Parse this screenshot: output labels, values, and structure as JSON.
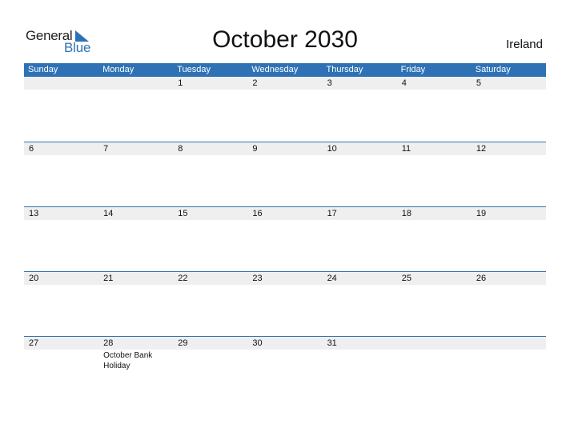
{
  "logo": {
    "word1": "General",
    "word2": "Blue"
  },
  "calendar": {
    "title": "October 2030",
    "country": "Ireland",
    "accent_color": "#2e72b5",
    "weekdays": [
      "Sunday",
      "Monday",
      "Tuesday",
      "Wednesday",
      "Thursday",
      "Friday",
      "Saturday"
    ],
    "weeks": [
      [
        {
          "day": ""
        },
        {
          "day": ""
        },
        {
          "day": "1"
        },
        {
          "day": "2"
        },
        {
          "day": "3"
        },
        {
          "day": "4"
        },
        {
          "day": "5"
        }
      ],
      [
        {
          "day": "6"
        },
        {
          "day": "7"
        },
        {
          "day": "8"
        },
        {
          "day": "9"
        },
        {
          "day": "10"
        },
        {
          "day": "11"
        },
        {
          "day": "12"
        }
      ],
      [
        {
          "day": "13"
        },
        {
          "day": "14"
        },
        {
          "day": "15"
        },
        {
          "day": "16"
        },
        {
          "day": "17"
        },
        {
          "day": "18"
        },
        {
          "day": "19"
        }
      ],
      [
        {
          "day": "20"
        },
        {
          "day": "21"
        },
        {
          "day": "22"
        },
        {
          "day": "23"
        },
        {
          "day": "24"
        },
        {
          "day": "25"
        },
        {
          "day": "26"
        }
      ],
      [
        {
          "day": "27"
        },
        {
          "day": "28",
          "event": "October Bank Holiday"
        },
        {
          "day": "29"
        },
        {
          "day": "30"
        },
        {
          "day": "31"
        },
        {
          "day": ""
        },
        {
          "day": ""
        }
      ]
    ]
  }
}
